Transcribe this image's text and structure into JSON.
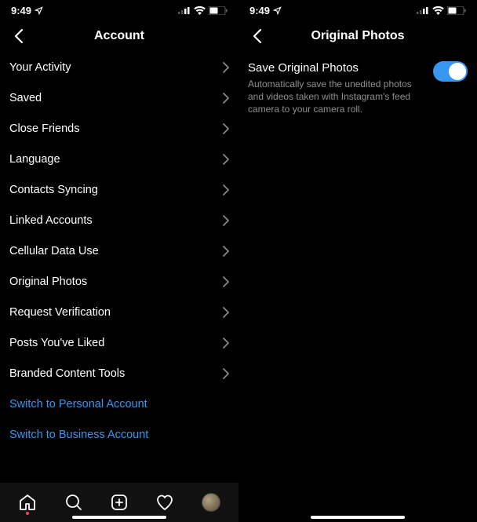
{
  "status": {
    "time": "9:49",
    "location_icon": "location-arrow"
  },
  "left": {
    "title": "Account",
    "items": [
      "Your Activity",
      "Saved",
      "Close Friends",
      "Language",
      "Contacts Syncing",
      "Linked Accounts",
      "Cellular Data Use",
      "Original Photos",
      "Request Verification",
      "Posts You've Liked",
      "Branded Content Tools"
    ],
    "links": [
      "Switch to Personal Account",
      "Switch to Business Account"
    ]
  },
  "right": {
    "title": "Original Photos",
    "toggle": {
      "label": "Save Original Photos",
      "description": "Automatically save the unedited photos and videos taken with Instagram's feed camera to your camera roll.",
      "on": true
    }
  }
}
